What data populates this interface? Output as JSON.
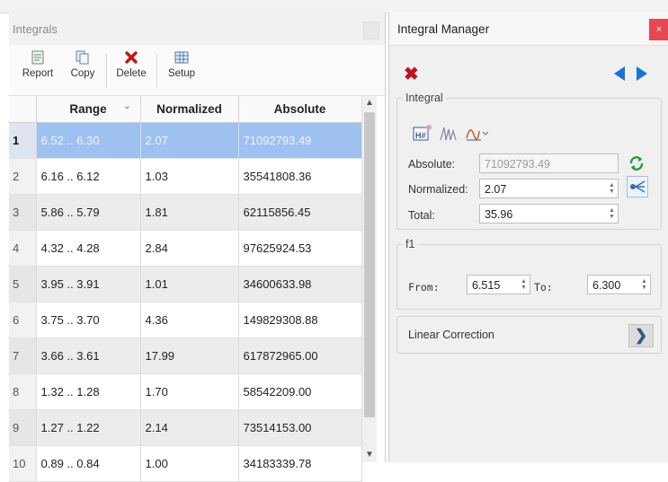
{
  "integrals_panel": {
    "title": "Integrals",
    "toolbar": {
      "report_label": "Report",
      "copy_label": "Copy",
      "delete_label": "Delete",
      "setup_label": "Setup"
    },
    "columns": [
      "Range",
      "Normalized",
      "Absolute"
    ],
    "rows": [
      {
        "idx": "1",
        "range": "6.52 .. 6.30",
        "normalized": "2.07",
        "absolute": "71092793.49"
      },
      {
        "idx": "2",
        "range": "6.16 .. 6.12",
        "normalized": "1.03",
        "absolute": "35541808.36"
      },
      {
        "idx": "3",
        "range": "5.86 .. 5.79",
        "normalized": "1.81",
        "absolute": "62115856.45"
      },
      {
        "idx": "4",
        "range": "4.32 .. 4.28",
        "normalized": "2.84",
        "absolute": "97625924.53"
      },
      {
        "idx": "5",
        "range": "3.95 .. 3.91",
        "normalized": "1.01",
        "absolute": "34600633.98"
      },
      {
        "idx": "6",
        "range": "3.75 .. 3.70",
        "normalized": "4.36",
        "absolute": "149829308.88"
      },
      {
        "idx": "7",
        "range": "3.66 .. 3.61",
        "normalized": "17.99",
        "absolute": "617872965.00"
      },
      {
        "idx": "8",
        "range": "1.32 .. 1.28",
        "normalized": "1.70",
        "absolute": "58542209.00"
      },
      {
        "idx": "9",
        "range": "1.27 .. 1.22",
        "normalized": "2.14",
        "absolute": "73514153.00"
      },
      {
        "idx": "10",
        "range": "0.89 .. 0.84",
        "normalized": "1.00",
        "absolute": "34183339.78"
      }
    ],
    "selected_row": "1"
  },
  "manager": {
    "title": "Integral Manager",
    "close_glyph": "×",
    "integral_group": {
      "legend": "Integral",
      "absolute_label": "Absolute:",
      "absolute_value": "71092793.49",
      "normalized_label": "Normalized:",
      "normalized_value": "2.07",
      "total_label": "Total:",
      "total_value": "35.96"
    },
    "f1_group": {
      "legend": "f1",
      "from_label": "From:",
      "from_value": "6.515",
      "to_label": "To:",
      "to_value": "6.300"
    },
    "linear_correction_label": "Linear Correction"
  },
  "colors": {
    "selection": "#9ec1ef",
    "delete_red": "#c0141b",
    "nav_blue": "#1773d6",
    "close_red": "#e8474f",
    "refresh_green": "#2a9d3a"
  },
  "icons": [
    "report-icon",
    "copy-icon",
    "delete-icon",
    "setup-icon",
    "integral-table-icon",
    "integral-peaks-icon",
    "integral-curve-icon",
    "refresh-icon",
    "pick-icon",
    "chevron-right-icon"
  ]
}
